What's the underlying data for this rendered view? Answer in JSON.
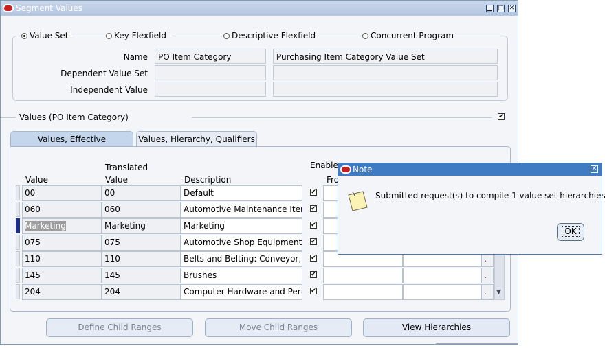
{
  "window": {
    "title": "Segment Values"
  },
  "radios": [
    {
      "label": "Value Set",
      "selected": true
    },
    {
      "label": "Key Flexfield",
      "selected": false
    },
    {
      "label": "Descriptive Flexfield",
      "selected": false
    },
    {
      "label": "Concurrent Program",
      "selected": false
    }
  ],
  "form": {
    "name_label": "Name",
    "name_value": "PO Item Category",
    "name_desc": "Purchasing Item Category Value Set",
    "dependent_label": "Dependent Value Set",
    "independent_label": "Independent Value"
  },
  "values_section": {
    "title": "Values (PO Item Category)",
    "checked": true
  },
  "tabs": [
    {
      "label": "Values, Effective",
      "active": true
    },
    {
      "label": "Values, Hierarchy, Qualifiers",
      "active": false
    }
  ],
  "table": {
    "headers": {
      "value": "Value",
      "translated_top": "Translated",
      "translated_bottom": "Value",
      "description": "Description",
      "enabled": "Enable",
      "from": "Fro"
    },
    "rows": [
      {
        "value": "00",
        "translated": "00",
        "description": "Default",
        "enabled": true
      },
      {
        "value": "060",
        "translated": "060",
        "description": "Automotive Maintenance Item",
        "enabled": true
      },
      {
        "value": "Marketing",
        "translated": "Marketing",
        "description": "Marketing",
        "enabled": true
      },
      {
        "value": "075",
        "translated": "075",
        "description": "Automotive Shop Equipment a",
        "enabled": true
      },
      {
        "value": "110",
        "translated": "110",
        "description": "Belts and Belting: Conveyor, E",
        "enabled": true
      },
      {
        "value": "145",
        "translated": "145",
        "description": "Brushes",
        "enabled": true
      },
      {
        "value": "204",
        "translated": "204",
        "description": "Computer Hardware and Perip",
        "enabled": true
      }
    ]
  },
  "buttons": {
    "define_child": "Define Child Ranges",
    "move_child": "Move Child Ranges",
    "view_hierarchies": "View Hierarchies"
  },
  "note": {
    "title": "Note",
    "message": "Submitted request(s) to compile 1 value set hierarchies",
    "ok": "OK"
  },
  "colors": {
    "titlebar": "#b4c6e0",
    "note_titlebar": "#3e7bc3",
    "current_row": "#1a2f8c"
  }
}
